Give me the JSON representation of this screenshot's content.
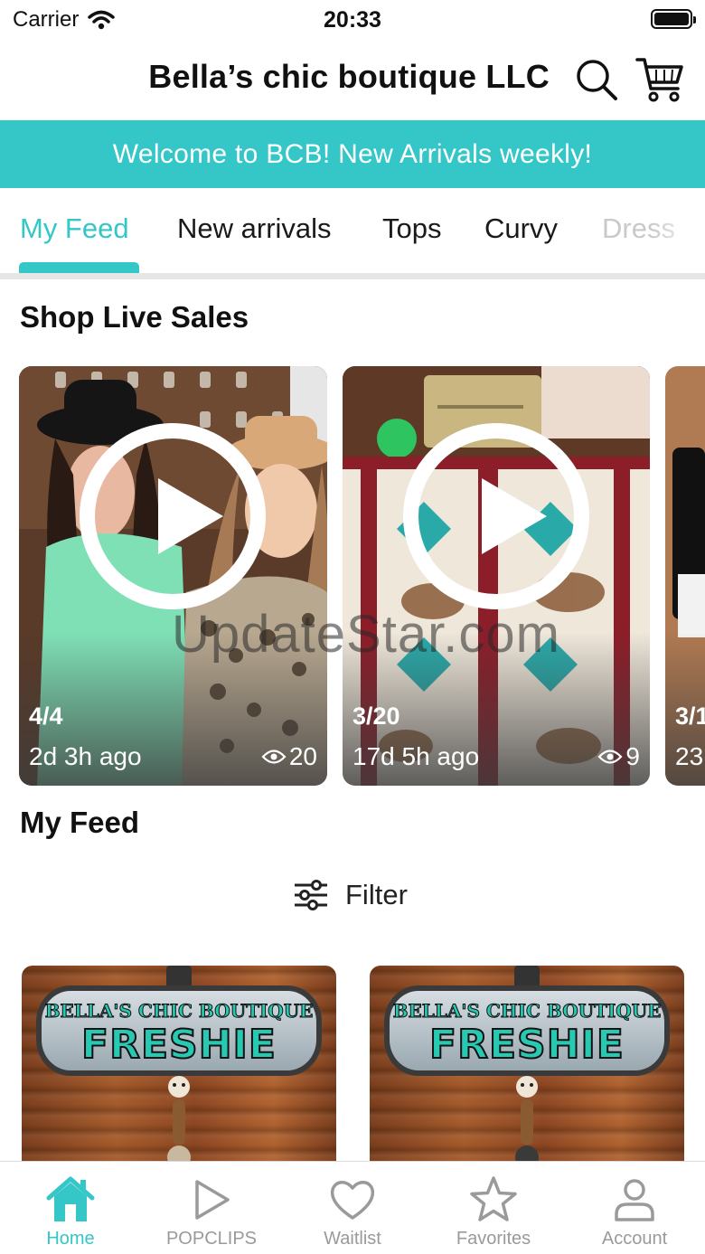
{
  "status_bar": {
    "carrier": "Carrier",
    "time": "20:33",
    "battery_level": 1.0
  },
  "header": {
    "title": "Bella’s chic boutique LLC",
    "search_icon": "search-icon",
    "cart_icon": "cart-icon"
  },
  "banner": {
    "text": "Welcome to BCB! New Arrivals weekly!",
    "color": "#35c6c8"
  },
  "tabs": [
    {
      "label": "My Feed",
      "active": true
    },
    {
      "label": "New arrivals",
      "active": false
    },
    {
      "label": "Tops",
      "active": false
    },
    {
      "label": "Curvy",
      "active": false
    },
    {
      "label": "Dress",
      "active": false
    }
  ],
  "live_sales": {
    "title": "Shop Live Sales",
    "cards": [
      {
        "date": "4/4",
        "ago": "2d 3h ago",
        "views": "20"
      },
      {
        "date": "3/20",
        "ago": "17d 5h ago",
        "views": "9"
      },
      {
        "date": "3/1",
        "ago": "23",
        "views": ""
      }
    ]
  },
  "watermark": "UpdateStar.com",
  "feed": {
    "title": "My Feed",
    "filter_label": "Filter",
    "cards": [
      {
        "logo_top": "BELLA'S CHIC BOUTIQUE",
        "logo_main": "FRESHIE"
      },
      {
        "logo_top": "BELLA'S CHIC BOUTIQUE",
        "logo_main": "FRESHIE"
      }
    ]
  },
  "bottom_nav": [
    {
      "label": "Home",
      "icon": "home-icon",
      "active": true
    },
    {
      "label": "POPCLIPS",
      "icon": "play-icon",
      "active": false
    },
    {
      "label": "Waitlist",
      "icon": "heart-icon",
      "active": false
    },
    {
      "label": "Favorites",
      "icon": "star-icon",
      "active": false
    },
    {
      "label": "Account",
      "icon": "account-icon",
      "active": false
    }
  ],
  "colors": {
    "accent": "#35c6c8",
    "inactive": "#9a9a9a"
  }
}
